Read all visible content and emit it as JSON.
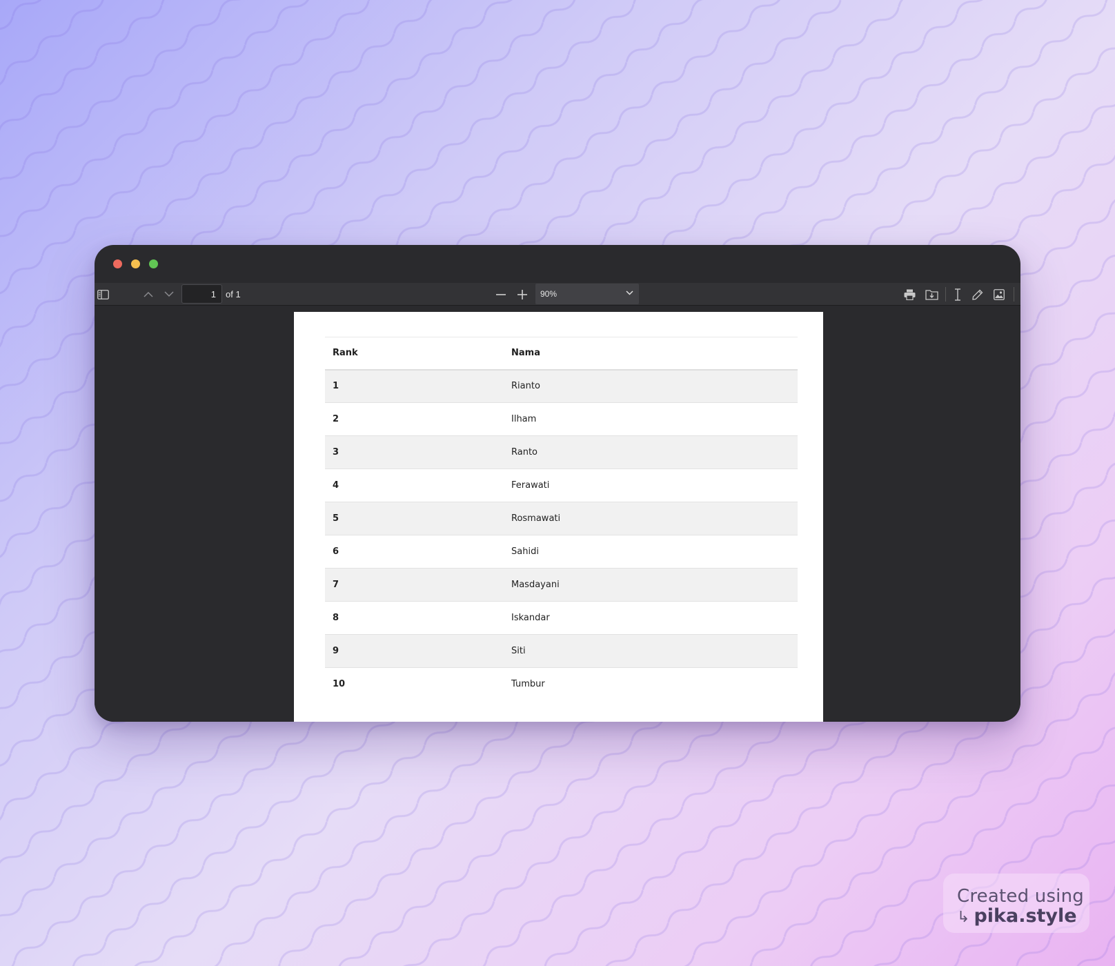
{
  "toolbar": {
    "page_number": "1",
    "page_of": "of 1",
    "zoom": "90%"
  },
  "table": {
    "headers": [
      "Rank",
      "Nama"
    ],
    "rows": [
      {
        "rank": "1",
        "nama": "Rianto"
      },
      {
        "rank": "2",
        "nama": "Ilham"
      },
      {
        "rank": "3",
        "nama": "Ranto"
      },
      {
        "rank": "4",
        "nama": "Ferawati"
      },
      {
        "rank": "5",
        "nama": "Rosmawati"
      },
      {
        "rank": "6",
        "nama": "Sahidi"
      },
      {
        "rank": "7",
        "nama": "Masdayani"
      },
      {
        "rank": "8",
        "nama": "Iskandar"
      },
      {
        "rank": "9",
        "nama": "Siti"
      },
      {
        "rank": "10",
        "nama": "Tumbur"
      }
    ]
  },
  "watermark": {
    "line1": "Created using",
    "arrow": "↳",
    "line2": "pika.style"
  },
  "icons": {
    "sidebar": "sidebar-toggle-icon",
    "prev": "chevron-up-icon",
    "next": "chevron-down-icon",
    "zoom_out": "minus-icon",
    "zoom_in": "plus-icon",
    "print": "print-icon",
    "save": "download-icon",
    "text_select": "text-cursor-icon",
    "annotate": "pen-icon",
    "image": "image-icon"
  },
  "colors": {
    "window": "#2a2a2d",
    "toolbar": "#333336",
    "traffic_red": "#ed6a5e",
    "traffic_yellow": "#f5bf4f",
    "traffic_green": "#61c554",
    "row_stripe": "#f1f1f1"
  }
}
